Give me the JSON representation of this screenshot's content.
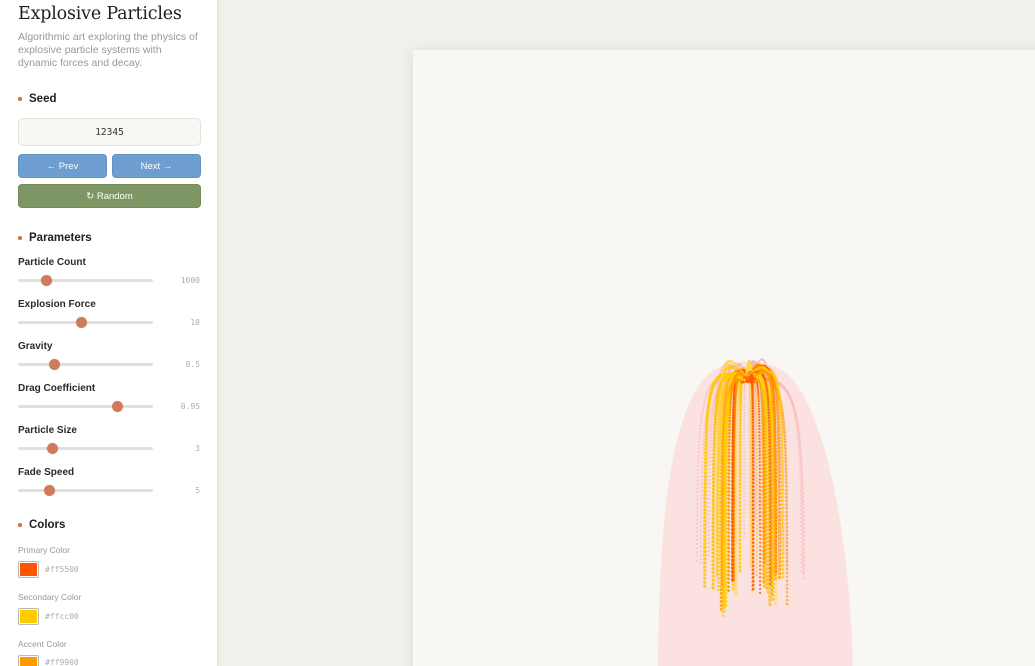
{
  "app": {
    "title": "Explosive Particles",
    "description": "Algorithmic art exploring the physics of explosive particle systems with dynamic forces and decay."
  },
  "seed": {
    "section_title": "Seed",
    "value": "12345",
    "prev_label": "← Prev",
    "next_label": "Next →",
    "random_label": "↻ Random"
  },
  "parameters": {
    "section_title": "Parameters",
    "items": [
      {
        "label": "Particle Count",
        "value": "1000",
        "fraction": 0.21
      },
      {
        "label": "Explosion Force",
        "value": "10",
        "fraction": 0.47
      },
      {
        "label": "Gravity",
        "value": "0.5",
        "fraction": 0.27
      },
      {
        "label": "Drag Coefficient",
        "value": "0.95",
        "fraction": 0.73
      },
      {
        "label": "Particle Size",
        "value": "3",
        "fraction": 0.25
      },
      {
        "label": "Fade Speed",
        "value": "5",
        "fraction": 0.23
      }
    ]
  },
  "colors": {
    "section_title": "Colors",
    "items": [
      {
        "label": "Primary Color",
        "hex": "#ff5500"
      },
      {
        "label": "Secondary Color",
        "hex": "#ffcc00"
      },
      {
        "label": "Accent Color",
        "hex": "#ff9900"
      }
    ]
  },
  "theme": {
    "button_blue": "#6e9ecf",
    "button_green": "#7e9564",
    "slider_thumb": "#cf7a5a",
    "halo_pink": "#fcd9d8"
  }
}
